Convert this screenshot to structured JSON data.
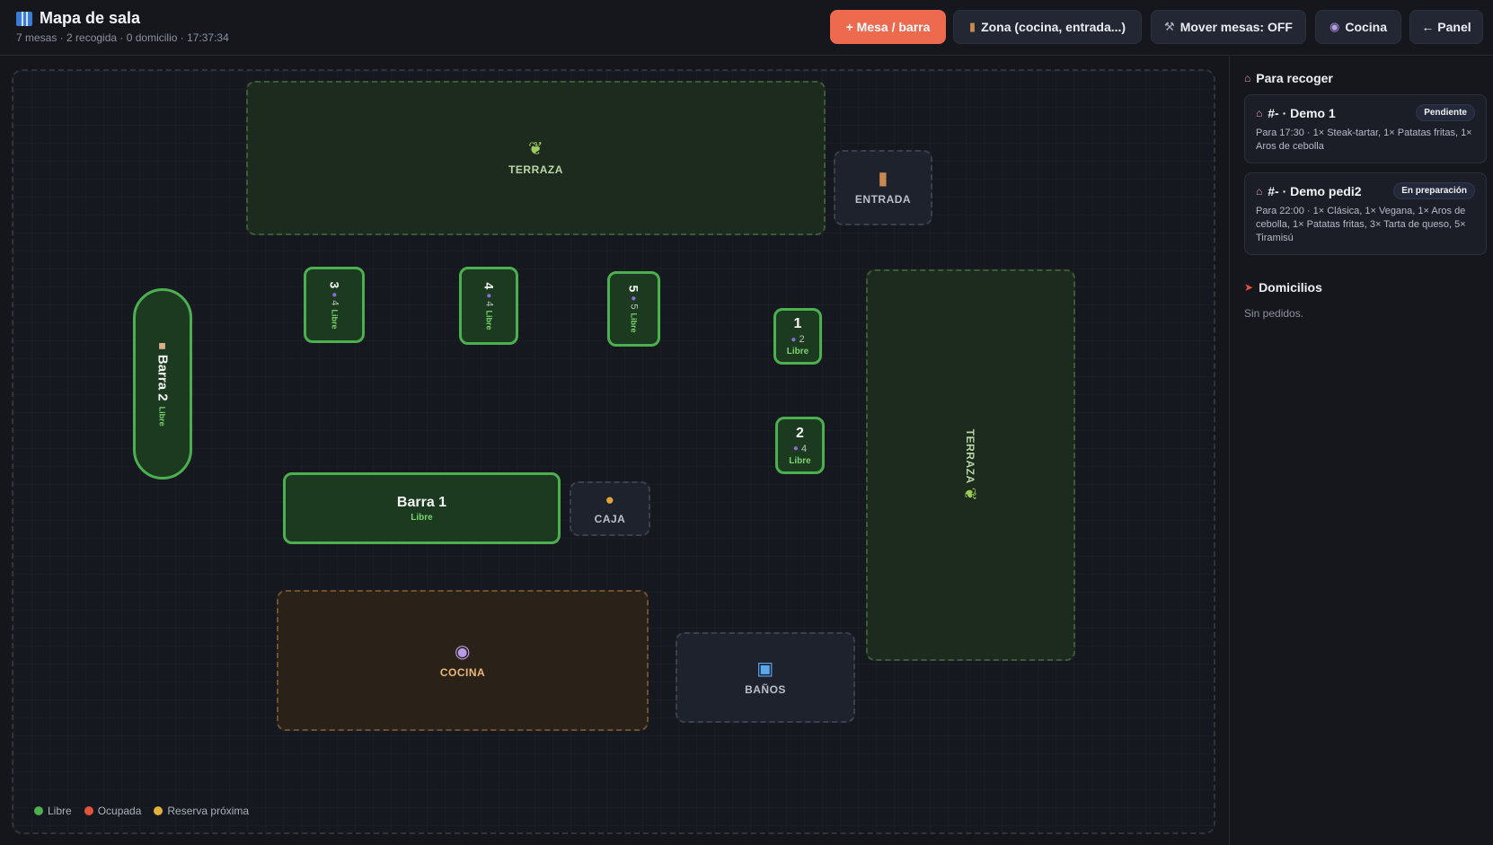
{
  "header": {
    "title": "Mapa de sala",
    "subtitle": "7 mesas · 2 recogida · 0 domicilio · 17:37:34",
    "buttons": {
      "add_table": "+ Mesa / barra",
      "zone": "Zona (cocina, entrada...)",
      "move": "Mover mesas: OFF",
      "kitchen": "Cocina",
      "panel": "← Panel"
    },
    "icons": {
      "title": "map-icon",
      "zone": "door-icon",
      "move": "wrench-icon",
      "kitchen": "chef-icon"
    }
  },
  "zones": {
    "terraza_top": "TERRAZA",
    "entrada": "ENTRADA",
    "terraza_right": "TERRAZA",
    "caja": "CAJA",
    "cocina": "COCINA",
    "banos": "BAÑOS"
  },
  "tables": {
    "t3": {
      "num": "3",
      "seats": "4",
      "status": "Libre"
    },
    "t4": {
      "num": "4",
      "seats": "4",
      "status": "Libre"
    },
    "t5": {
      "num": "5",
      "seats": "5",
      "status": "Libre"
    },
    "t1": {
      "num": "1",
      "seats": "2",
      "status": "Libre"
    },
    "t2": {
      "num": "2",
      "seats": "4",
      "status": "Libre"
    },
    "barra1": {
      "num": "Barra 1",
      "status": "Libre"
    },
    "barra2": {
      "num": "Barra 2",
      "status": "Libre"
    }
  },
  "legend": {
    "libre": "Libre",
    "ocupada": "Ocupada",
    "reserva": "Reserva próxima",
    "colors": {
      "libre": "#4caf50",
      "ocupada": "#e5533d",
      "reserva": "#e0b23a"
    }
  },
  "panel": {
    "pickup_title": "Para recoger",
    "orders": [
      {
        "name": "#- · Demo 1",
        "badge": "Pendiente",
        "desc": "Para 17:30 · 1× Steak-tartar, 1× Patatas fritas, 1× Aros de cebolla"
      },
      {
        "name": "#- · Demo pedi2",
        "badge": "En preparación",
        "desc": "Para 22:00 · 1× Clásica, 1× Vegana, 1× Aros de cebolla, 1× Patatas fritas, 3× Tarta de queso, 5× Tiramisú"
      }
    ],
    "delivery_title": "Domicilios",
    "delivery_empty": "Sin pedidos."
  },
  "colors": {
    "accent": "#ee6a4f",
    "table_border": "#4caf50",
    "table_fill": "#1b3a1f"
  }
}
